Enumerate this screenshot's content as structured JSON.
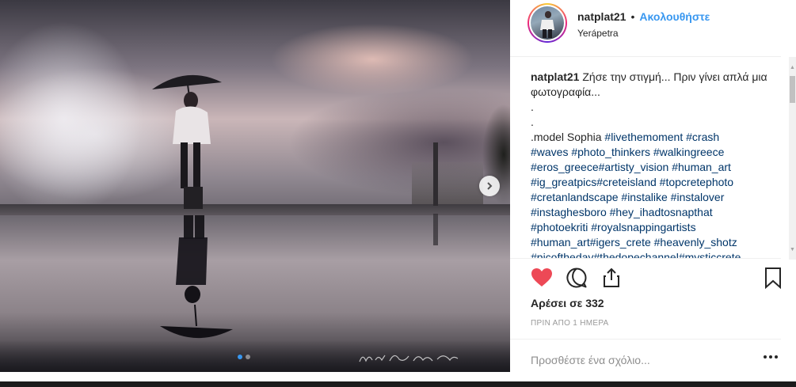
{
  "post": {
    "username": "natplat21",
    "bullet": "•",
    "follow_label": "Ακολουθήστε",
    "location": "Yerápetra",
    "caption_user": "natplat21",
    "caption_text": "Ζήσε την στιγμή... Πριν γίνει απλά μια φωτογραφία...",
    "caption_lines": [
      ".",
      ".",
      ".model Sophia"
    ],
    "hashtag_lines": [
      "#livethemoment #crash",
      "#waves #photo_thinkers #walkingreece",
      "#eros_greece#artisty_vision #human_art",
      "#ig_greatpics#creteisland #topcretephoto",
      "#cretanlandscape #instalike #instalover",
      "#instaghesboro #hey_ihadtosnapthat",
      "#photoekriti #royalsnappingartists",
      "#human_art#igers_crete #heavenly_shotz",
      "#picoftheday#thedopechannel#mysticcrete"
    ],
    "likes_text": "Αρέσει σε 332",
    "time_ago": "ΠΡΙΝ ΑΠΟ 1 ΗΜΕΡΑ",
    "comment_placeholder": "Προσθέστε ένα σχόλιο..."
  },
  "photo": {
    "signature": "Nikita Lazarides",
    "carousel_count": 2,
    "carousel_active": 1
  },
  "icons": {
    "like": "heart-icon",
    "comment": "comment-icon",
    "share": "share-icon",
    "save": "bookmark-icon",
    "next": "chevron-right-icon",
    "more": "more-options-icon"
  },
  "colors": {
    "like_red": "#ed4956",
    "link_blue": "#3897f0",
    "hashtag_blue": "#003569"
  }
}
